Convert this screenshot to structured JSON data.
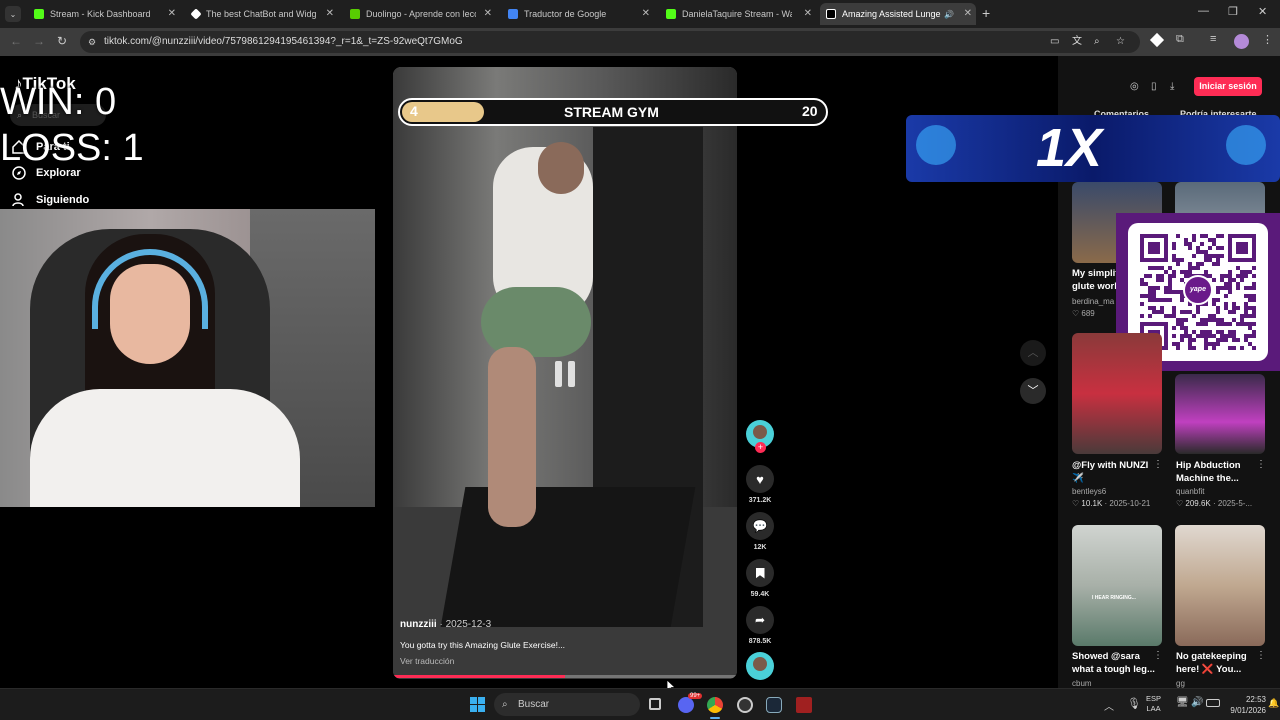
{
  "browser": {
    "tabs": [
      {
        "title": "Stream - Kick Dashboard",
        "color": "#53fc18"
      },
      {
        "title": "The best ChatBot and Widgets",
        "color": "#ffffff"
      },
      {
        "title": "Duolingo - Aprende con leccio",
        "color": "#58cc02"
      },
      {
        "title": "Traductor de Google",
        "color": "#4285f4"
      },
      {
        "title": "DanielaTaquire Stream - Watch",
        "color": "#53fc18"
      },
      {
        "title": "Amazing Assisted Lunge fo",
        "color": "#ffffff"
      }
    ],
    "new_tab": "+",
    "url": "tiktok.com/@nunzziii/video/7579861294195461394?_r=1&_t=ZS-92weQt7GMoG"
  },
  "overlay": {
    "win": "WIN: 0",
    "loss": "LOSS: 1",
    "score_left": "4",
    "banner_title": "STREAM GYM",
    "score_right": "20",
    "sponsor_logo": "1X",
    "qr_brand": "yape"
  },
  "tiktok": {
    "logo": "TikTok",
    "search_placeholder": "Buscar",
    "nav": [
      {
        "label": "Para ti",
        "icon": "home-icon"
      },
      {
        "label": "Explorar",
        "icon": "compass-icon"
      },
      {
        "label": "Siguiendo",
        "icon": "following-icon"
      }
    ],
    "login_button": "Iniciar sesión",
    "right_tabs": [
      "Comentarios",
      "Podría interesarte"
    ],
    "video": {
      "author": "nunzziii",
      "date": "2025-12-3",
      "caption": "You gotta try this Amazing Glute Exercise!...",
      "translate": "Ver traducción",
      "progress": 0.5,
      "likes": "371.2K",
      "comments": "12K",
      "saves": "59.4K",
      "shares": "878.5K"
    },
    "suggested": [
      {
        "title": "My simplifi glute work",
        "author": "berdina_ma",
        "likes": "689",
        "date": "",
        "color1": "#3a4a6a",
        "color2": "#8a6a4a"
      },
      {
        "title": "",
        "author": "",
        "likes": "",
        "date": "",
        "color1": "#5a6a7a",
        "color2": "#a0a8b0"
      },
      {
        "title": "@Fly with NUNZI ✈️",
        "author": "bentleys6",
        "likes": "10.1K",
        "date": "2025-10-21",
        "color1": "#c83040",
        "color2": "#4a3a3a"
      },
      {
        "title": "Hip Abduction Machine the...",
        "author": "quanbfit",
        "likes": "209.6K",
        "date": "2025-5-...",
        "color1": "#3a2a4a",
        "color2": "#c040c0"
      },
      {
        "title": "Showed @sara what a tough leg...",
        "author": "cbum",
        "likes": "",
        "date": "",
        "color1": "#c0c8c0",
        "color2": "#5a7a6a"
      },
      {
        "title": "No gatekeeping here! ❌ You...",
        "author": "gg",
        "likes": "",
        "date": "",
        "color1": "#d0c8c0",
        "color2": "#8a6a5a"
      }
    ],
    "thumb_caption": "I HEAR RINGING..."
  },
  "taskbar": {
    "search_placeholder": "Buscar",
    "lang_top": "ESP",
    "lang_bottom": "LAA",
    "time": "22:53",
    "date": "9/01/2026",
    "badge": "99+"
  }
}
